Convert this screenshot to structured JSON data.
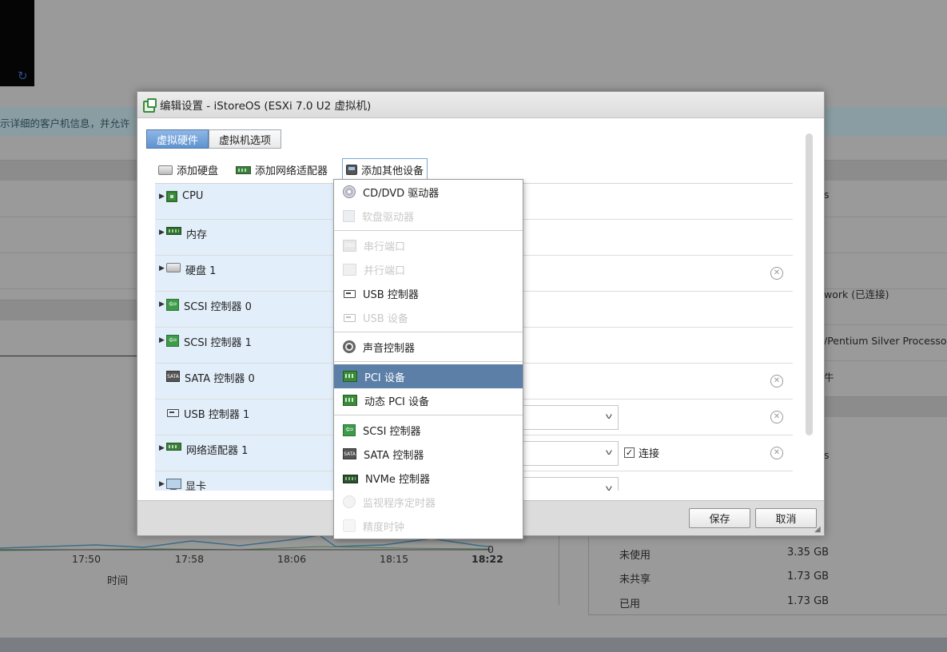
{
  "background": {
    "info_text": "示详细的客户机信息，并允许",
    "right_texts": [
      "s",
      "work (已连接)",
      "/Pentium Silver Processor",
      "牛",
      "s"
    ],
    "chart": {
      "x_ticks": [
        "17:50",
        "17:58",
        "18:06",
        "18:15",
        "18:22"
      ],
      "y_tick": "0",
      "x_title": "时间"
    },
    "memory": [
      {
        "key": "未使用",
        "value": "3.35 GB"
      },
      {
        "key": "未共享",
        "value": "1.73 GB"
      },
      {
        "key": "已用",
        "value": "1.73 GB"
      }
    ]
  },
  "dialog": {
    "title": "编辑设置 - iStoreOS (ESXi 7.0 U2 虚拟机)",
    "tabs": [
      "虚拟硬件",
      "虚拟机选项"
    ],
    "toolbar": {
      "add_disk": "添加硬盘",
      "add_nic": "添加网络适配器",
      "add_other": "添加其他设备"
    },
    "hardware": [
      {
        "label": "CPU",
        "icon": "cpu-icon"
      },
      {
        "label": "内存",
        "icon": "memory-icon"
      },
      {
        "label": "硬盘 1",
        "icon": "hard-disk-icon"
      },
      {
        "label": "SCSI 控制器 0",
        "icon": "scsi-controller-icon"
      },
      {
        "label": "SCSI 控制器 1",
        "icon": "scsi-controller-icon"
      },
      {
        "label": "SATA 控制器 0",
        "icon": "sata-controller-icon"
      },
      {
        "label": "USB 控制器 1",
        "icon": "usb-controller-icon"
      },
      {
        "label": "网络适配器 1",
        "icon": "network-adapter-icon",
        "connect_label": "连接",
        "connected": true
      },
      {
        "label": "显卡",
        "icon": "video-card-icon"
      }
    ],
    "footer": {
      "save": "保存",
      "cancel": "取消"
    }
  },
  "dropdown": {
    "items": [
      {
        "label": "CD/DVD 驱动器",
        "icon": "cd-dvd-icon",
        "enabled": true
      },
      {
        "label": "软盘驱动器",
        "icon": "floppy-icon",
        "enabled": false
      },
      {
        "label": "串行端口",
        "icon": "serial-port-icon",
        "enabled": false
      },
      {
        "label": "并行端口",
        "icon": "parallel-port-icon",
        "enabled": false
      },
      {
        "label": "USB 控制器",
        "icon": "usb-controller-icon",
        "enabled": true
      },
      {
        "label": "USB 设备",
        "icon": "usb-device-icon",
        "enabled": false
      },
      {
        "label": "声音控制器",
        "icon": "sound-controller-icon",
        "enabled": true
      },
      {
        "label": "PCI 设备",
        "icon": "pci-device-icon",
        "enabled": true,
        "selected": true
      },
      {
        "label": "动态 PCI 设备",
        "icon": "dynamic-pci-icon",
        "enabled": true
      },
      {
        "label": "SCSI 控制器",
        "icon": "scsi-controller-icon",
        "enabled": true
      },
      {
        "label": "SATA 控制器",
        "icon": "sata-controller-icon",
        "enabled": true
      },
      {
        "label": "NVMe 控制器",
        "icon": "nvme-controller-icon",
        "enabled": true
      },
      {
        "label": "监视程序定时器",
        "icon": "watchdog-timer-icon",
        "enabled": false
      },
      {
        "label": "精度时钟",
        "icon": "precision-clock-icon",
        "enabled": false
      }
    ]
  },
  "colors": {
    "tab_active": "#5e93d0",
    "menu_selected": "#5b7fa6",
    "hardware_label_bg": "#e2eef9"
  }
}
